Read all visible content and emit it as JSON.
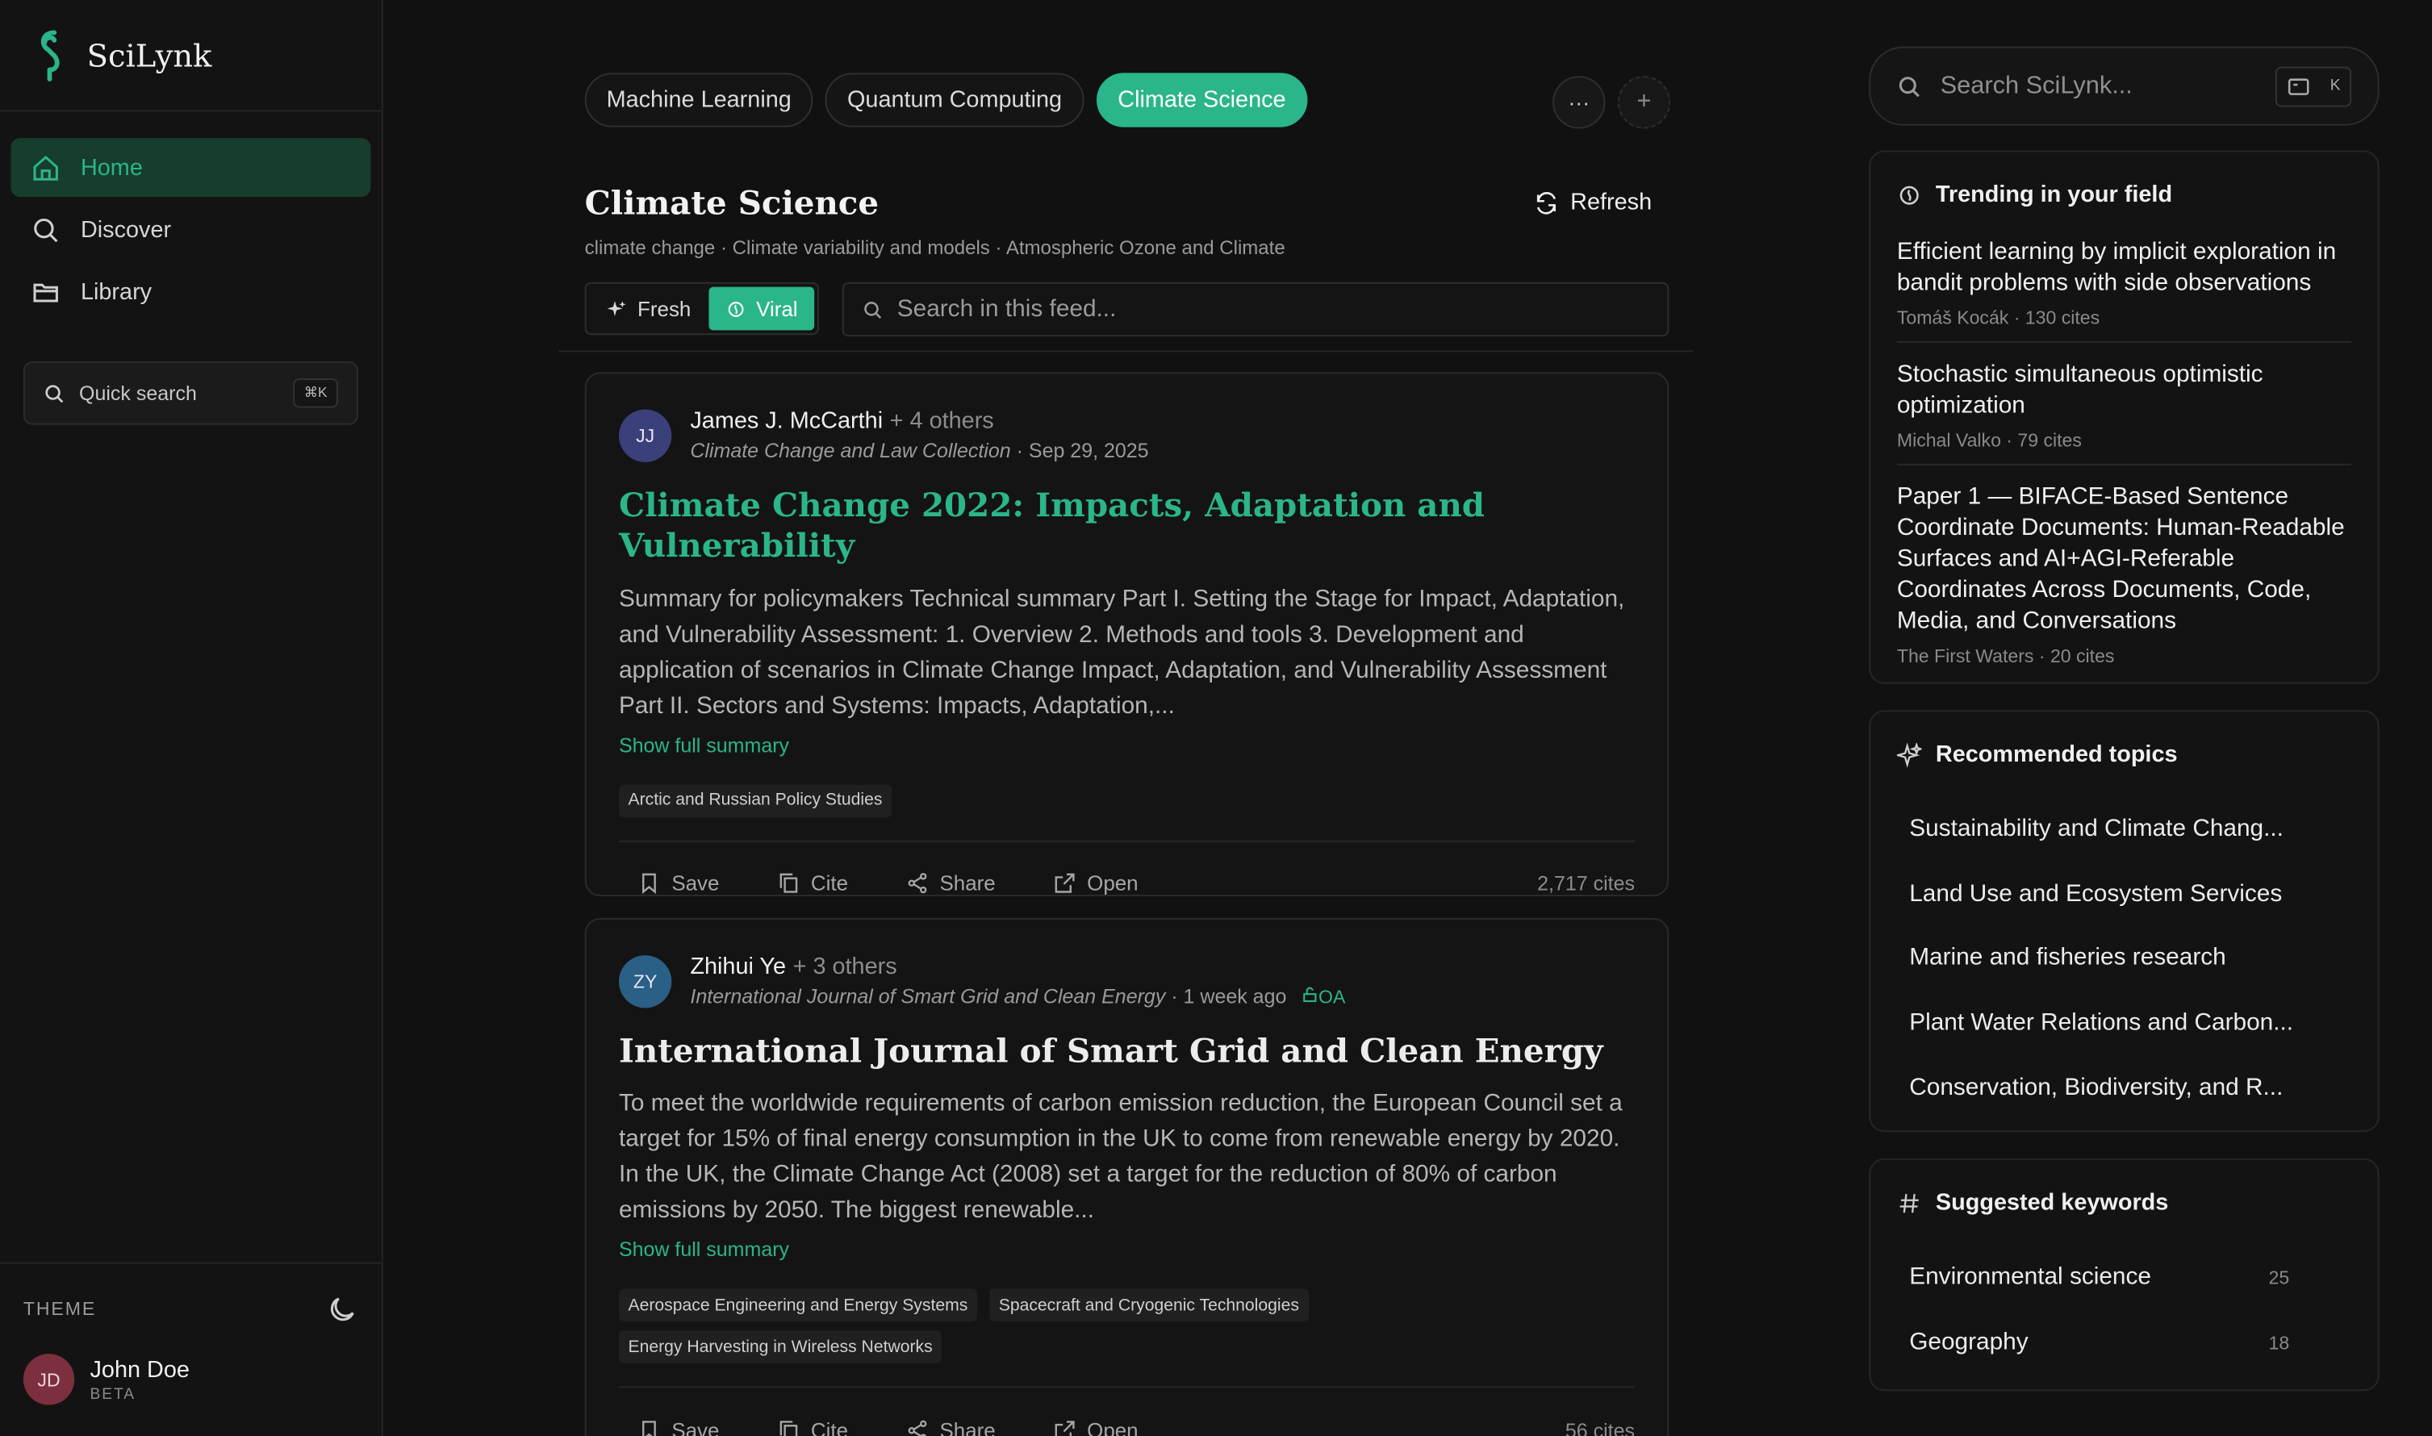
{
  "brand": {
    "name": "SciLynk"
  },
  "nav": [
    {
      "label": "Home",
      "icon": "home-icon"
    },
    {
      "label": "Discover",
      "icon": "search-icon"
    },
    {
      "label": "Library",
      "icon": "folder-icon"
    }
  ],
  "quick_search": {
    "label": "Quick search",
    "shortcut": "⌘K"
  },
  "theme": {
    "label": "THEME",
    "icon": "moon-icon"
  },
  "user": {
    "initials": "JD",
    "name": "John Doe",
    "tag": "BETA"
  },
  "topic_tabs": [
    {
      "label": "Machine Learning",
      "active": false
    },
    {
      "label": "Quantum Computing",
      "active": false
    },
    {
      "label": "Climate Science",
      "active": true
    }
  ],
  "feed": {
    "more_label": "···",
    "add_label": "+",
    "title": "Climate Science",
    "subtitle": "climate change · Climate variability and models · Atmospheric Ozone and Climate",
    "refresh_label": "Refresh",
    "modes": [
      {
        "label": "Fresh",
        "active": false
      },
      {
        "label": "Viral",
        "active": true
      }
    ],
    "search_placeholder": "Search in this feed..."
  },
  "papers": [
    {
      "initials": "JJ",
      "avatar_color": "#3b3f7a",
      "author": "James J. McCarthi",
      "others": "+ 4 others",
      "venue": "Climate Change and Law Collection",
      "date": "· Sep 29, 2025",
      "oa": "",
      "title": "Climate Change 2022: Impacts, Adaptation and Vulnerability",
      "summary": "Summary for policymakers Technical summary Part I. Setting the Stage for Impact, Adaptation, and Vulnerability Assessment: 1. Overview 2. Methods and tools 3. Development and application of scenarios in Climate Change Impact, Adaptation, and Vulnerability Assessment Part II. Sectors and Systems: Impacts, Adaptation,...",
      "show_more": "Show full summary",
      "tags": [
        "Arctic and Russian Policy Studies"
      ],
      "actions": [
        "Save",
        "Cite",
        "Share",
        "Open"
      ],
      "cites": "2,717 cites"
    },
    {
      "initials": "ZY",
      "avatar_color": "#2a5f86",
      "author": "Zhihui Ye",
      "others": "+ 3 others",
      "venue": "International Journal of Smart Grid and Clean Energy",
      "date": "· 1 week ago",
      "oa": "OA",
      "title": "International Journal of Smart Grid and Clean Energy",
      "summary": "To meet the worldwide requirements of carbon emission reduction, the European Council set a target for 15% of final energy consumption in the UK to come from renewable energy by 2020. In the UK, the Climate Change Act (2008) set a target for the reduction of 80% of carbon emissions by 2050. The biggest renewable...",
      "show_more": "Show full summary",
      "tags": [
        "Aerospace Engineering and Energy Systems",
        "Spacecraft and Cryogenic Technologies",
        "Energy Harvesting in Wireless Networks"
      ],
      "actions": [
        "Save",
        "Cite",
        "Share",
        "Open"
      ],
      "cites": "56 cites"
    }
  ],
  "right": {
    "search_placeholder": "Search SciLynk...",
    "search_shortcut": "K",
    "trending": {
      "title": "Trending in your field",
      "items": [
        {
          "title": "Efficient learning by implicit exploration in bandit problems with side observations",
          "meta": "Tomáš Kocák · 130 cites"
        },
        {
          "title": "Stochastic simultaneous optimistic optimization",
          "meta": "Michal Valko · 79 cites"
        },
        {
          "title": "Paper 1 — BIFACE-Based Sentence Coordinate Documents: Human-Readable Surfaces and AI+AGI-Referable Coordinates Across Documents, Code, Media, and Conversations",
          "meta": "The First Waters · 20 cites"
        }
      ]
    },
    "topics": {
      "title": "Recommended topics",
      "items": [
        "Sustainability and Climate Chang...",
        "Land Use and Ecosystem Services",
        "Marine and fisheries research",
        "Plant Water Relations and Carbon...",
        "Conservation, Biodiversity, and R..."
      ]
    },
    "keywords": {
      "title": "Suggested keywords",
      "items": [
        {
          "label": "Environmental science",
          "count": "25"
        },
        {
          "label": "Geography",
          "count": "18"
        }
      ]
    }
  },
  "colors": {
    "accent": "#2bb58a",
    "background": "#111111",
    "nav_active_bg": "#173d2d"
  }
}
